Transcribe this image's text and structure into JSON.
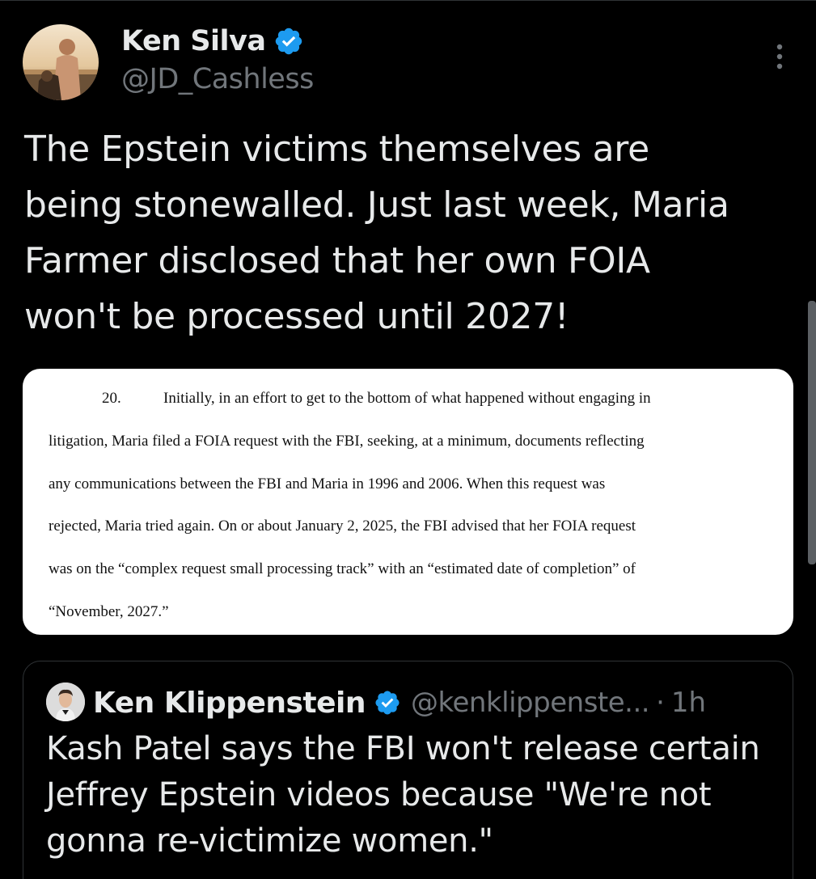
{
  "author": {
    "display_name": "Ken Silva",
    "handle": "@JD_Cashless",
    "verified": true,
    "avatar_icon": "avatar-photo"
  },
  "menu": {
    "icon": "more-vertical-icon"
  },
  "tweet": {
    "text": "The Epstein victims themselves are\nbeing stonewalled. Just last week, Maria\nFarmer disclosed that her own FOIA\nwon't be processed until 2027!"
  },
  "document_image": {
    "paragraph_number": "20.",
    "lines": [
      "Initially, in an effort to get to the bottom of what happened without engaging in",
      "litigation, Maria filed a FOIA request with the FBI, seeking, at a minimum, documents reflecting",
      "any communications between the FBI and Maria in 1996 and 2006. When this request was",
      "rejected, Maria tried again. On or about January 2, 2025, the FBI advised that her FOIA request",
      "was on the “complex request small processing track” with an “estimated date of completion” of",
      "“November, 2027.”"
    ]
  },
  "quoted_tweet": {
    "display_name": "Ken Klippenstein",
    "verified": true,
    "handle": "@kenklippenste...",
    "separator": "·",
    "time": "1h",
    "text": "Kash Patel says the FBI won't release certain\nJeffrey Epstein videos because \"We're not\ngonna re-victimize women.\""
  },
  "colors": {
    "background": "#000000",
    "text_primary": "#e7e9ea",
    "text_secondary": "#71767b",
    "verified_blue": "#1d9bf0",
    "border": "#2f3336"
  }
}
